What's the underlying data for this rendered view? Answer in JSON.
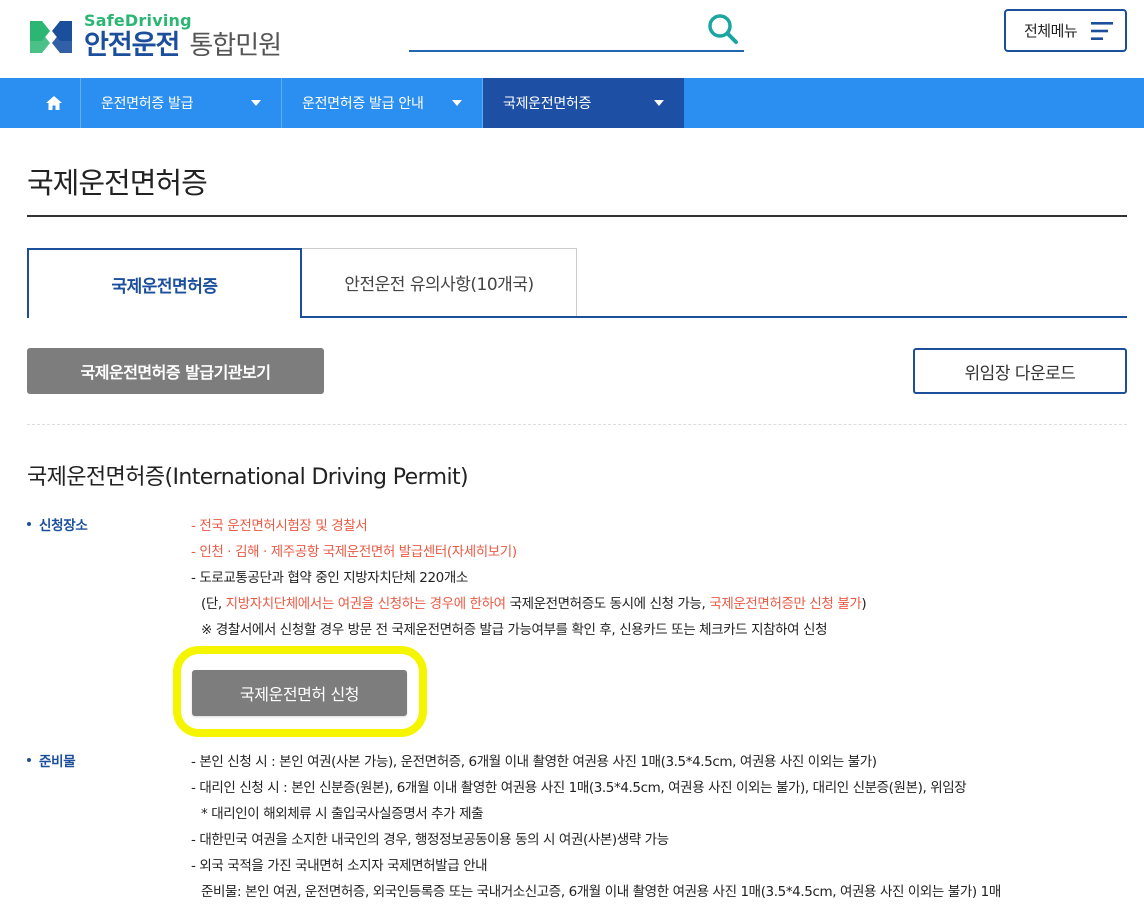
{
  "header": {
    "logo_en": "SafeDriving",
    "logo_ko": "안전운전",
    "logo_sub": "통합민원",
    "search_placeholder": "",
    "menu_label": "전체메뉴"
  },
  "nav": {
    "items": [
      {
        "label": "운전면허증 발급"
      },
      {
        "label": "운전면허증 발급 안내"
      },
      {
        "label": "국제운전면허증"
      }
    ]
  },
  "page": {
    "title": "국제운전면허증",
    "tabs": [
      {
        "label": "국제운전면허증"
      },
      {
        "label": "안전운전 유의사항(10개국)"
      }
    ],
    "issuer_button": "국제운전면허증 발급기관보기",
    "download_button": "위임장 다운로드",
    "section_title": "국제운전면허증(International Driving Permit)"
  },
  "apply": {
    "label": "신청장소",
    "lines": {
      "l1": "- 전국 운전면허시험장 및 경찰서",
      "l2": "- 인천 · 김해 · 제주공항 국제운전면허 발급센터(자세히보기)",
      "l3": "- 도로교통공단과 협약 중인 지방자치단체 220개소",
      "l4a": "(단, ",
      "l4b": "지방자치단체에서는 여권을 신청하는 경우에 한하여",
      "l4c": " 국제운전면허증도 동시에 신청 가능, ",
      "l4d": "국제운전면허증만 신청 불가",
      "l4e": ")",
      "l5": "※ 경찰서에서 신청할 경우 방문 전 국제운전면허증 발급 가능여부를 확인 후, 신용카드 또는 체크카드 지참하여 신청"
    },
    "button": "국제운전면허 신청"
  },
  "prep": {
    "label": "준비물",
    "lines": [
      "- 본인 신청 시 : 본인 여권(사본 가능), 운전면허증, 6개월 이내 촬영한 여권용 사진 1매(3.5*4.5cm, 여권용 사진 이외는 불가)",
      "- 대리인 신청 시 : 본인 신분증(원본), 6개월 이내 촬영한 여권용 사진 1매(3.5*4.5cm, 여권용 사진 이외는 불가), 대리인 신분증(원본), 위임장",
      "* 대리인이 해외체류 시 출입국사실증명서 추가 제출",
      "- 대한민국 여권을 소지한 내국인의 경우, 행정정보공동이용 동의 시 여권(사본)생략 가능",
      "- 외국 국적을 가진 국내면허 소지자 국제면허발급 안내",
      "준비물: 본인 여권, 운전면허증, 외국인등록증 또는 국내거소신고증, 6개월 이내 촬영한 여권용 사진 1매(3.5*4.5cm, 여권용 사진 이외는 불가) 1매"
    ]
  },
  "colors": {
    "nav": "#2b8ff1",
    "nav_active": "#1d4fa5",
    "brand_blue": "#1b4f9c",
    "brand_green": "#2bb673",
    "highlight": "#f5f500",
    "red_text": "#e95b45"
  }
}
